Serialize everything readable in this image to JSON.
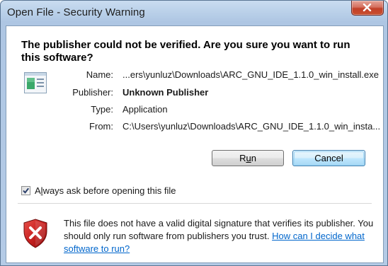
{
  "window": {
    "title": "Open File - Security Warning",
    "close_icon": "close-icon"
  },
  "dialog": {
    "headline": "The publisher could not be verified.  Are you sure you want to run this software?",
    "fields": [
      {
        "label": "Name:",
        "value": "...ers\\yunluz\\Downloads\\ARC_GNU_IDE_1.1.0_win_install.exe"
      },
      {
        "label": "Publisher:",
        "value": "Unknown Publisher"
      },
      {
        "label": "Type:",
        "value": "Application"
      },
      {
        "label": "From:",
        "value": "C:\\Users\\yunluz\\Downloads\\ARC_GNU_IDE_1.1.0_win_insta..."
      }
    ],
    "buttons": {
      "run_label_prefix": "R",
      "run_label_underlined": "u",
      "run_label_suffix": "n",
      "cancel_label": "Cancel"
    },
    "checkbox": {
      "label_prefix": "A",
      "label_underlined": "l",
      "label_suffix": "ways ask before opening this file",
      "checked": true
    },
    "warning": {
      "text": "This file does not have a valid digital signature that verifies its publisher.  You should only run software from publishers you trust.",
      "link_text": "How can I decide what software to run?"
    }
  },
  "colors": {
    "link": "#0066cc",
    "default_button_border": "#3c7fb1",
    "shield_red": "#c8201f"
  }
}
